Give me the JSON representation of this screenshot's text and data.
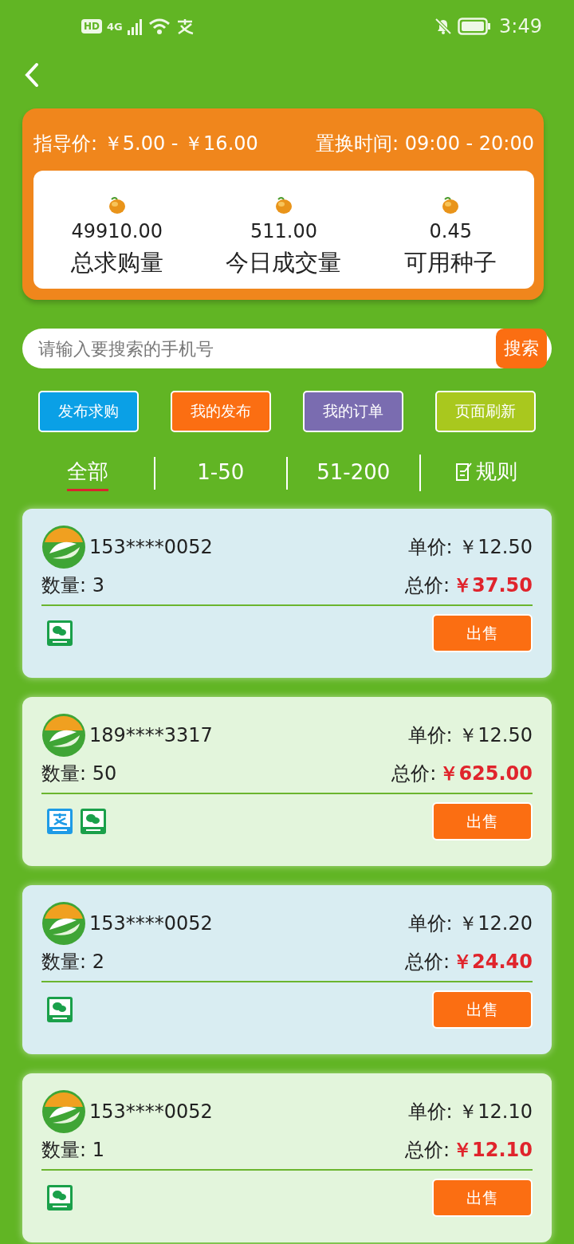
{
  "status_bar": {
    "hd": "HD",
    "network": "4G",
    "time": "3:49"
  },
  "header": {
    "guide_label": "指导价:",
    "guide_value": "￥5.00 - ￥16.00",
    "time_label": "置换时间:",
    "time_value": "09:00 - 20:00",
    "stats": [
      {
        "value": "49910.00",
        "label": "总求购量"
      },
      {
        "value": "511.00",
        "label": "今日成交量"
      },
      {
        "value": "0.45",
        "label": "可用种子"
      }
    ]
  },
  "search": {
    "placeholder": "请输入要搜索的手机号",
    "button": "搜索"
  },
  "actions": [
    {
      "label": "发布求购",
      "color": "#0aa0e6"
    },
    {
      "label": "我的发布",
      "color": "#fb6e12"
    },
    {
      "label": "我的订单",
      "color": "#7a6cb0"
    },
    {
      "label": "页面刷新",
      "color": "#a9c81e"
    }
  ],
  "tabs": [
    {
      "label": "全部",
      "selected": true,
      "kind": "plain"
    },
    {
      "label": "1-50",
      "selected": false,
      "kind": "plain"
    },
    {
      "label": "51-200",
      "selected": false,
      "kind": "plain"
    },
    {
      "label": "规则",
      "selected": false,
      "kind": "rules"
    }
  ],
  "listings": [
    {
      "phone": "153****0052",
      "unit_label": "单价:",
      "unit_price": "￥12.50",
      "qty_label": "数量:",
      "qty": "3",
      "total_label": "总价:",
      "total": "￥37.50",
      "color": "#d9edf2",
      "payments": [
        {
          "kind": "wechat"
        }
      ],
      "button": "出售"
    },
    {
      "phone": "189****3317",
      "unit_label": "单价:",
      "unit_price": "￥12.50",
      "qty_label": "数量:",
      "qty": "50",
      "total_label": "总价:",
      "total": "￥625.00",
      "color": "#e3f5dc",
      "payments": [
        {
          "kind": "alipay"
        },
        {
          "kind": "wechat"
        }
      ],
      "button": "出售"
    },
    {
      "phone": "153****0052",
      "unit_label": "单价:",
      "unit_price": "￥12.20",
      "qty_label": "数量:",
      "qty": "2",
      "total_label": "总价:",
      "total": "￥24.40",
      "color": "#d9edf2",
      "payments": [
        {
          "kind": "wechat"
        }
      ],
      "button": "出售"
    },
    {
      "phone": "153****0052",
      "unit_label": "单价:",
      "unit_price": "￥12.10",
      "qty_label": "数量:",
      "qty": "1",
      "total_label": "总价:",
      "total": "￥12.10",
      "color": "#e3f5dc",
      "payments": [
        {
          "kind": "wechat"
        }
      ],
      "button": "出售"
    }
  ]
}
